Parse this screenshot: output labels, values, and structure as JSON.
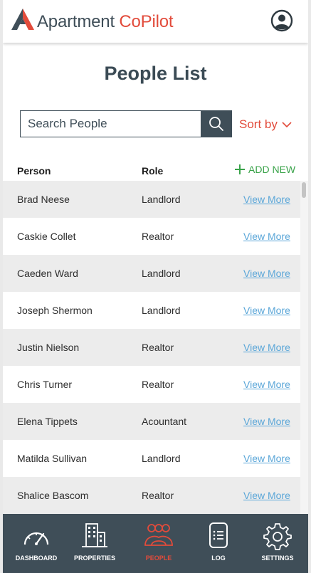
{
  "header": {
    "brand_main": "Apartment ",
    "brand_accent": "CoPilot"
  },
  "page_title": "People List",
  "search": {
    "placeholder": "Search People"
  },
  "sort": {
    "label": "Sort by"
  },
  "table": {
    "columns": [
      "Person",
      "Role"
    ],
    "add_new_label": "ADD NEW",
    "rows": [
      {
        "name": "Brad Neese",
        "role": "Landlord",
        "action": "View More"
      },
      {
        "name": "Caskie Collet",
        "role": "Realtor",
        "action": "View More"
      },
      {
        "name": "Caeden Ward",
        "role": "Landlord",
        "action": "View More"
      },
      {
        "name": "Joseph Shermon",
        "role": "Landlord",
        "action": "View More"
      },
      {
        "name": "Justin Nielson",
        "role": "Realtor",
        "action": "View More"
      },
      {
        "name": "Chris Turner",
        "role": "Realtor",
        "action": "View More"
      },
      {
        "name": "Elena Tippets",
        "role": "Acountant",
        "action": "View More"
      },
      {
        "name": "Matilda Sullivan",
        "role": "Landlord",
        "action": "View More"
      },
      {
        "name": "Shalice Bascom",
        "role": "Realtor",
        "action": "View More"
      }
    ]
  },
  "nav": {
    "items": [
      {
        "label": "DASHBOARD",
        "icon": "gauge-icon",
        "active": false
      },
      {
        "label": "PROPERTIES",
        "icon": "buildings-icon",
        "active": false
      },
      {
        "label": "PEOPLE",
        "icon": "people-icon",
        "active": true
      },
      {
        "label": "LOG",
        "icon": "document-icon",
        "active": false
      },
      {
        "label": "SETTINGS",
        "icon": "gear-icon",
        "active": false
      }
    ]
  },
  "colors": {
    "brand_dark": "#3f4e58",
    "accent_red": "#e24b3b",
    "add_green": "#3aa34a",
    "link_blue": "#5aa6d8",
    "row_alt": "#ececec"
  }
}
